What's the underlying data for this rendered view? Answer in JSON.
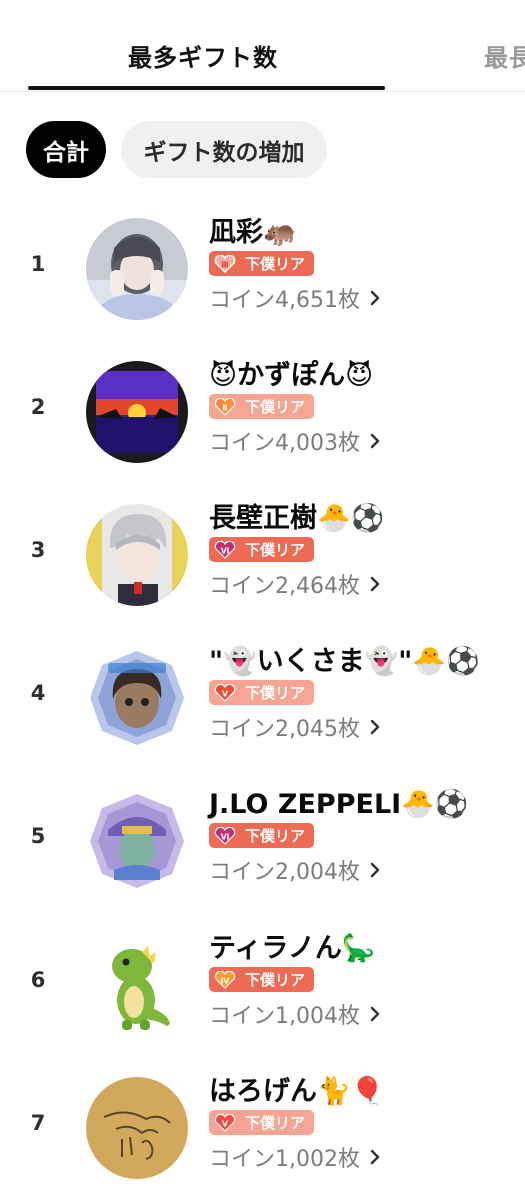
{
  "tabs": [
    {
      "label": "最多ギフト数",
      "active": true
    },
    {
      "label": "最長"
    }
  ],
  "filters": [
    {
      "label": "合計",
      "selected": true
    },
    {
      "label": "ギフト数の増加",
      "selected": false
    }
  ],
  "colors": {
    "badge_red": "#ef6a55",
    "badge_pink": "#f7a493",
    "chip_selected": "#000000"
  },
  "ranking": [
    {
      "rank": "1",
      "name": "凪彩🦛",
      "badge": "下僕リア",
      "badge_level": "Ⅲ",
      "badge_style": "red",
      "coins": "コイン4,651枚"
    },
    {
      "rank": "2",
      "name": "😈かずぽん😈",
      "badge": "下僕リア",
      "badge_level": "Ⅱ",
      "badge_style": "pink",
      "coins": "コイン4,003枚"
    },
    {
      "rank": "3",
      "name": "長壁正樹🐣⚽",
      "badge": "下僕リア",
      "badge_level": "Ⅵ",
      "badge_style": "red",
      "coins": "コイン2,464枚"
    },
    {
      "rank": "4",
      "name": "\"👻いくさま👻\"🐣⚽",
      "badge": "下僕リア",
      "badge_level": "Ⅴ",
      "badge_style": "pink",
      "coins": "コイン2,045枚"
    },
    {
      "rank": "5",
      "name": "J.LO ZEPPELI🐣⚽",
      "badge": "下僕リア",
      "badge_level": "Ⅵ",
      "badge_style": "red",
      "coins": "コイン2,004枚"
    },
    {
      "rank": "6",
      "name": "ティラノん🦕",
      "badge": "下僕リア",
      "badge_level": "Ⅳ",
      "badge_style": "red",
      "coins": "コイン1,004枚"
    },
    {
      "rank": "7",
      "name": "はろげん🐈🎈",
      "badge": "下僕リア",
      "badge_level": "Ⅴ",
      "badge_style": "pink",
      "coins": "コイン1,002枚"
    }
  ]
}
